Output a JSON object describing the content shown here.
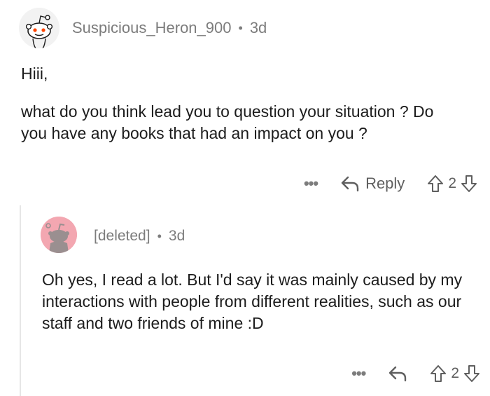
{
  "parent_comment": {
    "username": "Suspicious_Heron_900",
    "separator": "•",
    "age": "3d",
    "greeting": "Hiii,",
    "body": "what do you think lead you to question your situation ? Do you have any books that had an impact on you ?",
    "more_label": "•••",
    "reply_label": "Reply",
    "vote_count": "2",
    "avatar_icon": "snoo-avatar-icon"
  },
  "child_comment": {
    "username": "[deleted]",
    "separator": "•",
    "age": "3d",
    "body": "Oh yes, I read a lot. But I'd say it was mainly caused by my interactions with people from different realities, such as our staff and two friends of mine :D",
    "more_label": "•••",
    "vote_count": "2",
    "avatar_icon": "deleted-user-avatar-icon",
    "avatar_color": "#f3a7b1"
  },
  "colors": {
    "text": "#1c1c1c",
    "meta": "#7c7c7c",
    "thread_line": "#e6e6e6"
  }
}
